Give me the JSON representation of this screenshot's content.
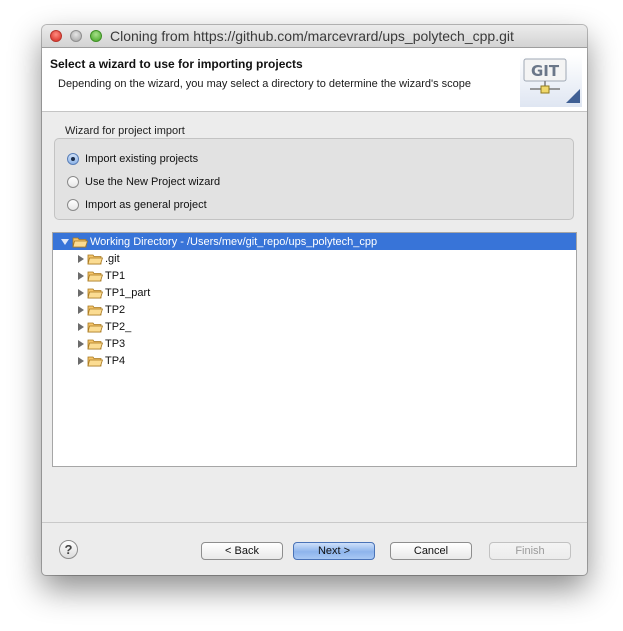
{
  "window": {
    "title": "Cloning from https://github.com/marcevrard/ups_polytech_cpp.git"
  },
  "header": {
    "title": "Select a wizard to use for importing projects",
    "description": "Depending on the wizard, you may select a directory to determine the wizard's scope",
    "logo_text": "GIT"
  },
  "wizard_group": {
    "label": "Wizard for project import",
    "options": [
      {
        "label": "Import existing projects",
        "checked": true
      },
      {
        "label": "Use the New Project wizard",
        "checked": false
      },
      {
        "label": "Import as general project",
        "checked": false
      }
    ]
  },
  "tree": {
    "root_label": "Working Directory - /Users/mev/git_repo/ups_polytech_cpp",
    "children": [
      ".git",
      "TP1",
      "TP1_part",
      "TP2",
      "TP2_",
      "TP3",
      "TP4"
    ]
  },
  "buttons": {
    "help": "?",
    "back": "< Back",
    "next": "Next >",
    "cancel": "Cancel",
    "finish": "Finish"
  },
  "colors": {
    "selection": "#3874d8",
    "folder": "#f5c56a"
  }
}
